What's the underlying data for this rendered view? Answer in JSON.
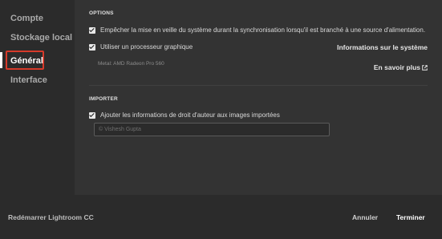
{
  "sidebar": {
    "items": [
      {
        "label": "Compte"
      },
      {
        "label": "Stockage local"
      },
      {
        "label": "Général",
        "active": true
      },
      {
        "label": "Interface"
      }
    ]
  },
  "options": {
    "title": "OPTIONS",
    "prevent_sleep": {
      "label": "Empêcher la mise en veille du système durant la synchronisation lorsqu'il est branché à une source d'alimentation.",
      "checked": true
    },
    "use_gpu": {
      "label": "Utiliser un processeur graphique",
      "checked": true
    },
    "gpu_info": "Metal: AMD Radeon Pro 560",
    "system_info_link": "Informations sur le système",
    "learn_more_link": "En savoir plus",
    "learn_more_icon": "external-link-icon"
  },
  "import": {
    "title": "IMPORTER",
    "copyright": {
      "label": "Ajouter les informations de droit d'auteur aux images importées",
      "checked": true
    },
    "copyright_value": "© Vishesh Gupta"
  },
  "footer": {
    "restart": "Redémarrer Lightroom CC",
    "cancel": "Annuler",
    "done": "Terminer"
  },
  "colors": {
    "active_outline": "#d63a2a",
    "content_bg": "#333333",
    "sidebar_bg": "#2b2b2b"
  }
}
